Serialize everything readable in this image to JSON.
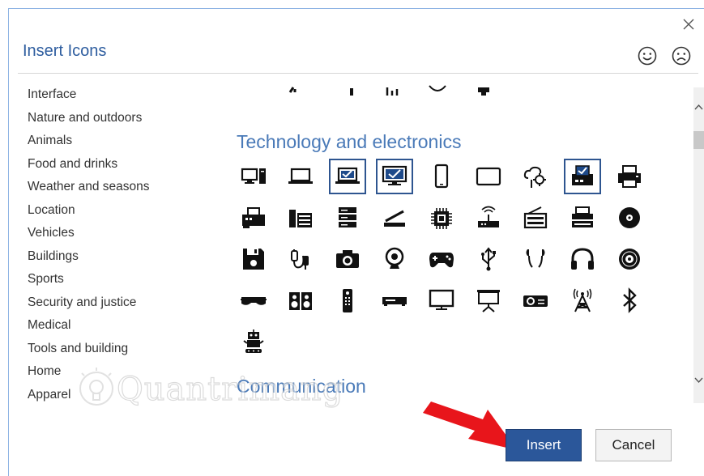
{
  "dialog": {
    "title": "Insert Icons",
    "close_label": "×"
  },
  "feedback": {
    "happy_icon": "smiley-icon",
    "sad_icon": "frown-icon"
  },
  "categories": [
    {
      "label": "Interface"
    },
    {
      "label": "Nature and outdoors"
    },
    {
      "label": "Animals"
    },
    {
      "label": "Food and drinks"
    },
    {
      "label": "Weather and seasons"
    },
    {
      "label": "Location"
    },
    {
      "label": "Vehicles"
    },
    {
      "label": "Buildings"
    },
    {
      "label": "Sports"
    },
    {
      "label": "Security and justice"
    },
    {
      "label": "Medical"
    },
    {
      "label": "Tools and building"
    },
    {
      "label": "Home"
    },
    {
      "label": "Apparel"
    }
  ],
  "sections": {
    "technology": "Technology and electronics",
    "communication": "Communication"
  },
  "icons": [
    {
      "name": "desktop-computer",
      "selected": false
    },
    {
      "name": "laptop",
      "selected": false
    },
    {
      "name": "laptop-checked",
      "selected": true
    },
    {
      "name": "monitor-checked",
      "selected": true
    },
    {
      "name": "smartphone",
      "selected": false
    },
    {
      "name": "tablet",
      "selected": false
    },
    {
      "name": "cloud-settings",
      "selected": false
    },
    {
      "name": "fax-checked",
      "selected": true
    },
    {
      "name": "printer",
      "selected": false
    },
    {
      "name": "fax-machine",
      "selected": false
    },
    {
      "name": "stereo",
      "selected": false
    },
    {
      "name": "server",
      "selected": false
    },
    {
      "name": "scanner",
      "selected": false
    },
    {
      "name": "processor",
      "selected": false
    },
    {
      "name": "wireless-router",
      "selected": false
    },
    {
      "name": "radio",
      "selected": false
    },
    {
      "name": "typewriter",
      "selected": false
    },
    {
      "name": "disc",
      "selected": false
    },
    {
      "name": "floppy-disk",
      "selected": false
    },
    {
      "name": "cable",
      "selected": false
    },
    {
      "name": "camera",
      "selected": false
    },
    {
      "name": "webcam",
      "selected": false
    },
    {
      "name": "game-controller",
      "selected": false
    },
    {
      "name": "usb",
      "selected": false
    },
    {
      "name": "earbuds",
      "selected": false
    },
    {
      "name": "headphones",
      "selected": false
    },
    {
      "name": "vinyl-record",
      "selected": false
    },
    {
      "name": "vr-headset",
      "selected": false
    },
    {
      "name": "speakers",
      "selected": false
    },
    {
      "name": "remote-control",
      "selected": false
    },
    {
      "name": "dvd-player",
      "selected": false
    },
    {
      "name": "television",
      "selected": false
    },
    {
      "name": "projector-screen",
      "selected": false
    },
    {
      "name": "projector",
      "selected": false
    },
    {
      "name": "antenna-tower",
      "selected": false
    },
    {
      "name": "bluetooth",
      "selected": false
    },
    {
      "name": "robot",
      "selected": false
    }
  ],
  "buttons": {
    "insert": "Insert",
    "cancel": "Cancel"
  },
  "watermark": {
    "text": "Quantrimang"
  },
  "colors": {
    "accent": "#2b579a",
    "title": "#2e5d9f",
    "section_title": "#4a7ab8",
    "arrow": "#e8151b"
  }
}
